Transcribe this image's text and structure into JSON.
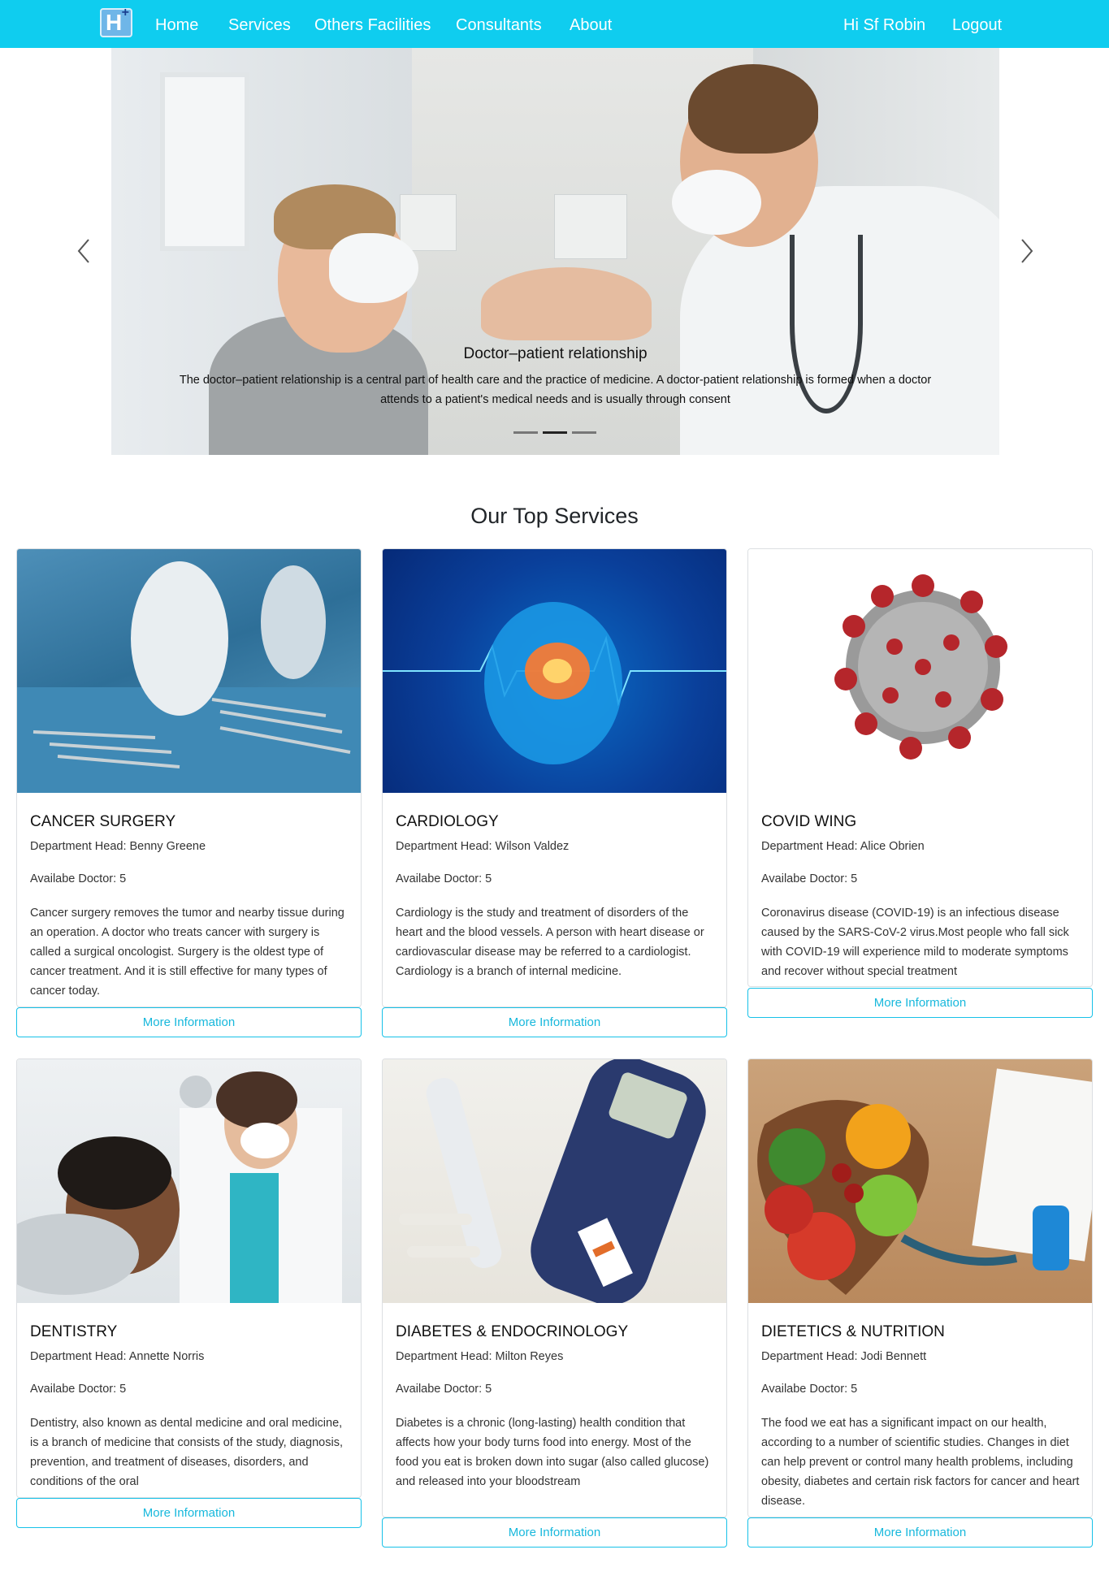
{
  "nav": {
    "logo_letter": "H",
    "logo_plus": "+",
    "items": [
      "Home",
      "Services",
      "Others Facilities",
      "Consultants",
      "About"
    ],
    "greeting": "Hi Sf Robin",
    "logout": "Logout"
  },
  "carousel": {
    "title": "Doctor–patient relationship",
    "text": "The doctor–patient relationship is a central part of health care and the practice of medicine. A doctor-patient relationship is formed when a doctor attends to a patient's medical needs and is usually through consent",
    "slide_count": 3,
    "active_slide": 2,
    "prev_icon": "chevron-left-icon",
    "next_icon": "chevron-right-icon"
  },
  "section": {
    "title": "Our Top Services"
  },
  "services": [
    {
      "title": "CANCER SURGERY",
      "head": "Department Head: Benny Greene",
      "doctors": "Availabe Doctor: 5",
      "desc": "Cancer surgery removes the tumor and nearby tissue during an operation. A doctor who treats cancer with surgery is called a surgical oncologist. Surgery is the oldest type of cancer treatment. And it is still effective for many types of cancer today.",
      "button": "More Information"
    },
    {
      "title": "CARDIOLOGY",
      "head": "Department Head: Wilson Valdez",
      "doctors": "Availabe Doctor: 5",
      "desc": "Cardiology is the study and treatment of disorders of the heart and the blood vessels. A person with heart disease or cardiovascular disease may be referred to a cardiologist. Cardiology is a branch of internal medicine.",
      "button": "More Information"
    },
    {
      "title": "COVID WING",
      "head": "Department Head: Alice Obrien",
      "doctors": "Availabe Doctor: 5",
      "desc": "Coronavirus disease (COVID-19) is an infectious disease caused by the SARS-CoV-2 virus.Most people who fall sick with COVID-19 will experience mild to moderate symptoms and recover without special treatment",
      "button": "More Information"
    },
    {
      "title": "DENTISTRY",
      "head": "Department Head: Annette Norris",
      "doctors": "Availabe Doctor: 5",
      "desc": "Dentistry, also known as dental medicine and oral medicine, is a branch of medicine that consists of the study, diagnosis, prevention, and treatment of diseases, disorders, and conditions of the oral",
      "button": "More Information"
    },
    {
      "title": "DIABETES & ENDOCRINOLOGY",
      "head": "Department Head: Milton Reyes",
      "doctors": "Availabe Doctor: 5",
      "desc": "Diabetes is a chronic (long-lasting) health condition that affects how your body turns food into energy. Most of the food you eat is broken down into sugar (also called glucose) and released into your bloodstream",
      "button": "More Information"
    },
    {
      "title": "DIETETICS & NUTRITION",
      "head": "Department Head: Jodi Bennett",
      "doctors": "Availabe Doctor: 5",
      "desc": "The food we eat has a significant impact on our health, according to a number of scientific studies. Changes in diet can help prevent or control many health problems, including obesity, diabetes and certain risk factors for cancer and heart disease.",
      "button": "More Information"
    }
  ],
  "colors": {
    "navbar": "#0fcdef",
    "accent": "#17c1e8"
  }
}
